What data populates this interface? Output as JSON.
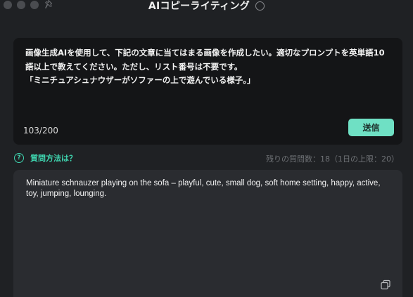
{
  "window": {
    "title": "AIコピーライティング"
  },
  "prompt": {
    "text": "画像生成AIを使用して、下記の文章に当てはまる画像を作成したい。適切なプロンプトを英単語10語以上で教えてください。ただし、リスト番号は不要です。\n「ミニチュアシュナウザーがソファーの上で遊んでいる様子。」",
    "char_count": "103/200",
    "send_label": "送信"
  },
  "help": {
    "label": "質問方法は？",
    "icon_glyph": "?"
  },
  "quota": {
    "text": "残りの質問数：18（1日の上限：20）"
  },
  "result": {
    "text": "Miniature schnauzer playing on the sofa – playful, cute, small dog, soft home setting, happy, active, toy, jumping, lounging."
  },
  "colors": {
    "accent": "#6fe0c4",
    "help_accent": "#3fd6b0",
    "background": "#1f2124",
    "input_bg": "#141517",
    "result_bg": "#2a2c30"
  },
  "icons": {
    "pin": "pin-icon",
    "info": "info-icon",
    "help": "question-circle-icon",
    "copy": "copy-icon"
  }
}
